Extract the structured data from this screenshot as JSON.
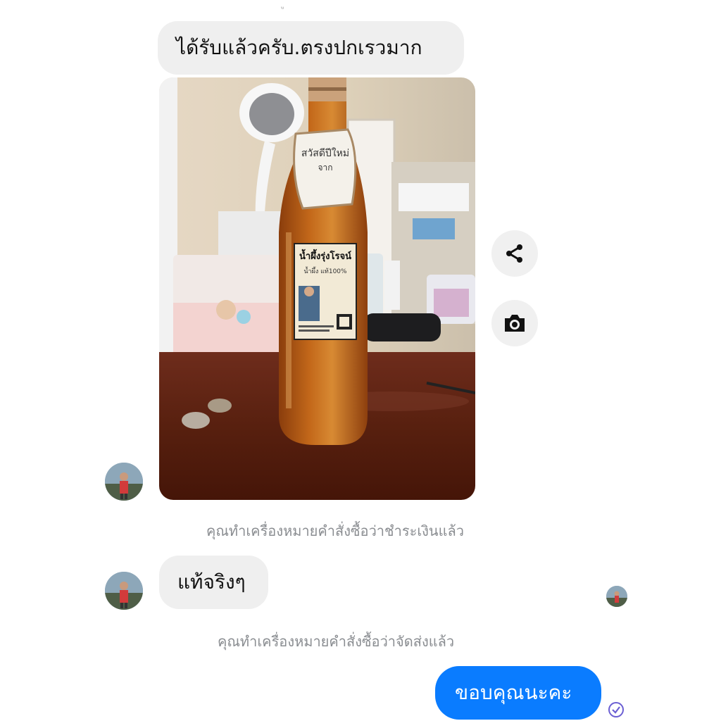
{
  "messages": {
    "received_1": "ได้รับแล้วครับ.ตรงปกเรวมาก",
    "status_paid": "คุณทำเครื่องหมายคำสั่งซื้อว่าชำระเงินแล้ว",
    "received_2": "แท้จริงๆ",
    "status_shipped": "คุณทำเครื่องหมายคำสั่งซื้อว่าจัดส่งแล้ว",
    "sent_1": "ขอบคุณนะคะ"
  },
  "photo": {
    "tag_text": "สวัสดีปีใหม่",
    "label_brand": "น้ำผึ้งรุ่งโรจน์",
    "label_sub": "น้ำผึ้ง แท้100%"
  },
  "actions": {
    "share_icon": "share-icon",
    "camera_icon": "camera-icon"
  },
  "colors": {
    "sent_bubble": "#0a7cff",
    "received_bubble": "#efefef",
    "status_text": "#8a8d91",
    "read_receipt": "#6b5fd3"
  }
}
